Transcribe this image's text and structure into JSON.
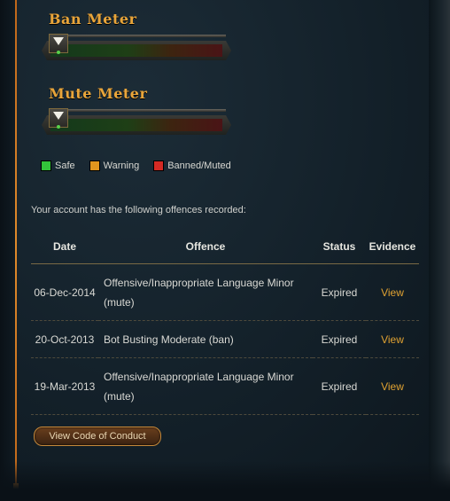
{
  "meters": {
    "ban": {
      "title": "Ban Meter",
      "level": 0
    },
    "mute": {
      "title": "Mute Meter",
      "level": 0
    }
  },
  "legend": [
    {
      "label": "Safe",
      "color": "#33c43a"
    },
    {
      "label": "Warning",
      "color": "#e0951e"
    },
    {
      "label": "Banned/Muted",
      "color": "#d42a24"
    }
  ],
  "intro_text": "Your account has the following offences recorded:",
  "table": {
    "headers": {
      "date": "Date",
      "offence": "Offence",
      "status": "Status",
      "evidence": "Evidence"
    },
    "rows": [
      {
        "date": "06-Dec-2014",
        "offence": "Offensive/Inappropriate Language Minor (mute)",
        "status": "Expired",
        "evidence": "View"
      },
      {
        "date": "20-Oct-2013",
        "offence": "Bot Busting Moderate (ban)",
        "status": "Expired",
        "evidence": "View"
      },
      {
        "date": "19-Mar-2013",
        "offence": "Offensive/Inappropriate Language Minor (mute)",
        "status": "Expired",
        "evidence": "View"
      }
    ]
  },
  "button": {
    "label": "View Code of Conduct"
  },
  "colors": {
    "accent": "#e9a53a",
    "link": "#e0a232"
  }
}
